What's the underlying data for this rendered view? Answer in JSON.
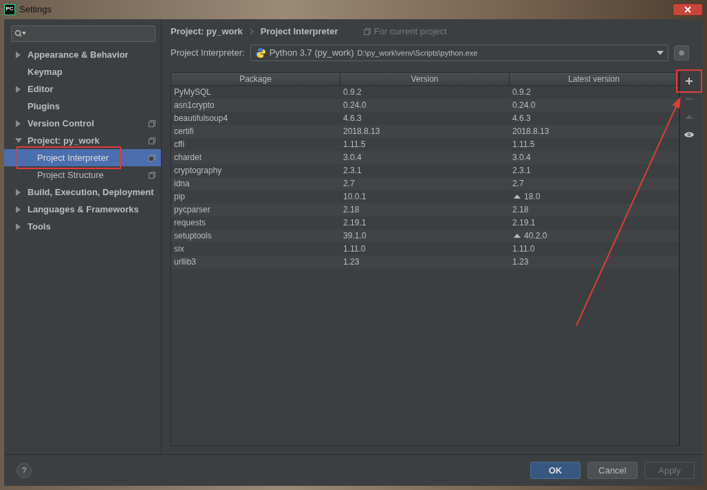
{
  "window": {
    "title": "Settings"
  },
  "app_icon": "PC",
  "sidebar": {
    "items": [
      {
        "label": "Appearance & Behavior",
        "expanded": false,
        "selected": false,
        "project_level": false,
        "highlighted": false
      },
      {
        "label": "Keymap",
        "selected": false,
        "project_level": false,
        "highlighted": false
      },
      {
        "label": "Editor",
        "expanded": false,
        "selected": false,
        "project_level": false,
        "highlighted": false
      },
      {
        "label": "Plugins",
        "selected": false,
        "project_level": false,
        "highlighted": false
      },
      {
        "label": "Version Control",
        "expanded": false,
        "selected": false,
        "project_level": true,
        "highlighted": false
      },
      {
        "label": "Project: py_work",
        "expanded": true,
        "selected": false,
        "project_level": true,
        "highlighted": false,
        "children": [
          {
            "label": "Project Interpreter",
            "selected": true,
            "project_level": true,
            "highlighted": true
          },
          {
            "label": "Project Structure",
            "selected": false,
            "project_level": true,
            "highlighted": false
          }
        ]
      },
      {
        "label": "Build, Execution, Deployment",
        "expanded": false,
        "selected": false,
        "project_level": false,
        "highlighted": false
      },
      {
        "label": "Languages & Frameworks",
        "expanded": false,
        "selected": false,
        "project_level": false,
        "highlighted": false
      },
      {
        "label": "Tools",
        "expanded": false,
        "selected": false,
        "project_level": false,
        "highlighted": false
      }
    ]
  },
  "breadcrumb": [
    "Project: py_work",
    "Project Interpreter"
  ],
  "scope_note": "For current project",
  "interpreter": {
    "label": "Project Interpreter:",
    "name": "Python 3.7 (py_work)",
    "path": "D:\\py_work\\venv\\Scripts\\python.exe"
  },
  "table": {
    "columns": [
      "Package",
      "Version",
      "Latest version"
    ],
    "rows": [
      {
        "package": "PyMySQL",
        "version": "0.9.2",
        "latest": "0.9.2",
        "upgrade": false
      },
      {
        "package": "asn1crypto",
        "version": "0.24.0",
        "latest": "0.24.0",
        "upgrade": false
      },
      {
        "package": "beautifulsoup4",
        "version": "4.6.3",
        "latest": "4.6.3",
        "upgrade": false
      },
      {
        "package": "certifi",
        "version": "2018.8.13",
        "latest": "2018.8.13",
        "upgrade": false
      },
      {
        "package": "cffi",
        "version": "1.11.5",
        "latest": "1.11.5",
        "upgrade": false
      },
      {
        "package": "chardet",
        "version": "3.0.4",
        "latest": "3.0.4",
        "upgrade": false
      },
      {
        "package": "cryptography",
        "version": "2.3.1",
        "latest": "2.3.1",
        "upgrade": false
      },
      {
        "package": "idna",
        "version": "2.7",
        "latest": "2.7",
        "upgrade": false
      },
      {
        "package": "pip",
        "version": "10.0.1",
        "latest": "18.0",
        "upgrade": true
      },
      {
        "package": "pycparser",
        "version": "2.18",
        "latest": "2.18",
        "upgrade": false
      },
      {
        "package": "requests",
        "version": "2.19.1",
        "latest": "2.19.1",
        "upgrade": false
      },
      {
        "package": "setuptools",
        "version": "39.1.0",
        "latest": "40.2.0",
        "upgrade": true
      },
      {
        "package": "six",
        "version": "1.11.0",
        "latest": "1.11.0",
        "upgrade": false
      },
      {
        "package": "urllib3",
        "version": "1.23",
        "latest": "1.23",
        "upgrade": false
      }
    ]
  },
  "tools": [
    {
      "kind": "add",
      "disabled": false,
      "highlighted": true
    },
    {
      "kind": "remove",
      "disabled": true,
      "highlighted": false
    },
    {
      "kind": "upgrade",
      "disabled": true,
      "highlighted": false
    },
    {
      "kind": "show",
      "disabled": false,
      "highlighted": false
    }
  ],
  "annotation_arrow": true,
  "help": "?",
  "buttons": [
    {
      "label": "OK",
      "kind": "primary",
      "disabled": false
    },
    {
      "label": "Cancel",
      "kind": "normal",
      "disabled": false
    },
    {
      "label": "Apply",
      "kind": "normal",
      "disabled": true
    }
  ]
}
